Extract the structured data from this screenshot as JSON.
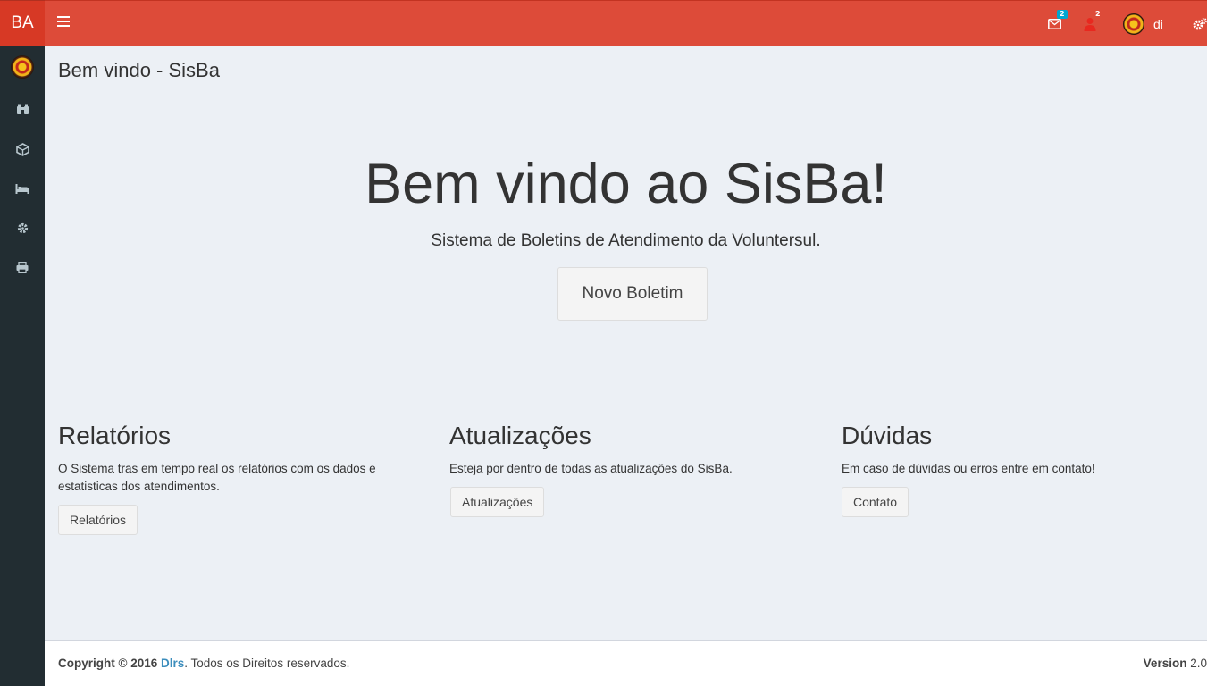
{
  "header": {
    "logo_text": "BA",
    "mail_badge": "2",
    "alert_badge": "2",
    "user_name": "di"
  },
  "sidebar": {
    "items": [
      {
        "icon": "emblem-icon"
      },
      {
        "icon": "binoculars-icon"
      },
      {
        "icon": "cube-icon"
      },
      {
        "icon": "bed-icon"
      },
      {
        "icon": "gear-icon"
      },
      {
        "icon": "print-icon"
      }
    ]
  },
  "page": {
    "title": "Bem vindo - SisBa"
  },
  "jumbotron": {
    "title": "Bem vindo ao SisBa!",
    "subtitle": "Sistema de Boletins de Atendimento da Voluntersul.",
    "button_label": "Novo Boletim"
  },
  "columns": [
    {
      "title": "Relatórios",
      "text": "O Sistema tras em tempo real os relatórios com os dados e estatisticas dos atendimentos.",
      "button_label": "Relatórios"
    },
    {
      "title": "Atualizações",
      "text": "Esteja por dentro de todas as atualizações do SisBa.",
      "button_label": "Atualizações"
    },
    {
      "title": "Dúvidas",
      "text": "Em caso de dúvidas ou erros entre em contato!",
      "button_label": "Contato"
    }
  ],
  "footer": {
    "copyright_prefix": "Copyright © 2016",
    "company": "Dlrs",
    "rights": ". Todos os Direitos reservados.",
    "version_label": "Version",
    "version_value": "2.0"
  },
  "colors": {
    "header_bg": "#dd4b39",
    "logo_bg": "#d73925",
    "sidebar_bg": "#222d32",
    "content_bg": "#ecf0f5",
    "badge_blue": "#00a7d0",
    "link": "#3c8dbc"
  }
}
